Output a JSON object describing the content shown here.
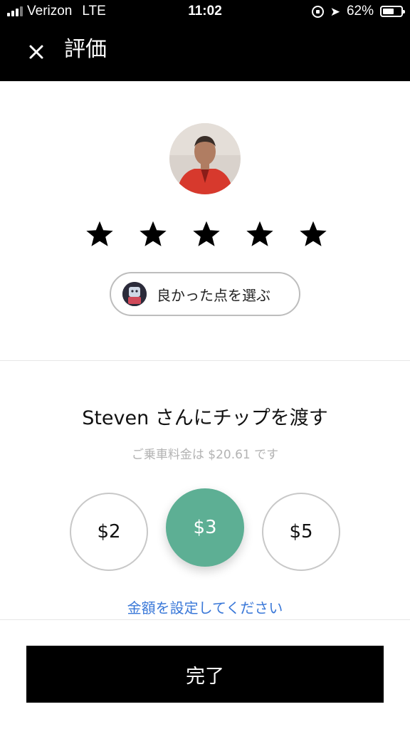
{
  "status_bar": {
    "carrier": "Verizon",
    "network": "LTE",
    "time": "11:02",
    "battery_percent": "62%",
    "battery_level": 0.62
  },
  "header": {
    "title": "評価"
  },
  "rating": {
    "stars_total": 5,
    "stars_filled": 5
  },
  "compliment": {
    "label": "良かった点を選ぶ"
  },
  "tip": {
    "title": "Steven さんにチップを渡す",
    "subtitle": "ご乗車料金は $20.61 です",
    "options": [
      "$2",
      "$3",
      "$5"
    ],
    "selected": "$3",
    "custom_label": "金額を設定してください"
  },
  "footer": {
    "done_label": "完了"
  },
  "colors": {
    "header_bg": "#000000",
    "accent_green": "#5daf94",
    "link_blue": "#3a78d8"
  }
}
